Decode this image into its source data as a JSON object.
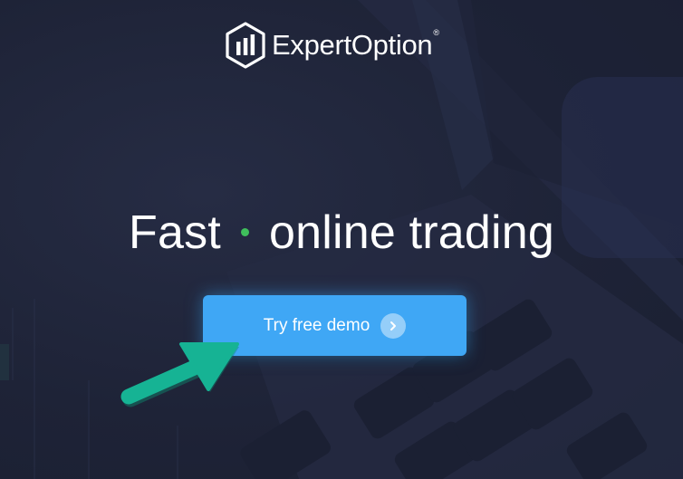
{
  "brand": {
    "name": "ExpertOption",
    "registered_mark": "®"
  },
  "hero": {
    "headline_part1": "Fast",
    "headline_part2": "online trading"
  },
  "cta": {
    "label": "Try free demo"
  },
  "icons": {
    "logo": "expertoption-logo-icon",
    "chevron": "chevron-right-icon",
    "pointer": "pointing-arrow-icon"
  },
  "colors": {
    "background": "#1f2438",
    "button": "#3fa7f5",
    "accent_dot": "#3fbf5c",
    "arrow": "#16b394"
  }
}
